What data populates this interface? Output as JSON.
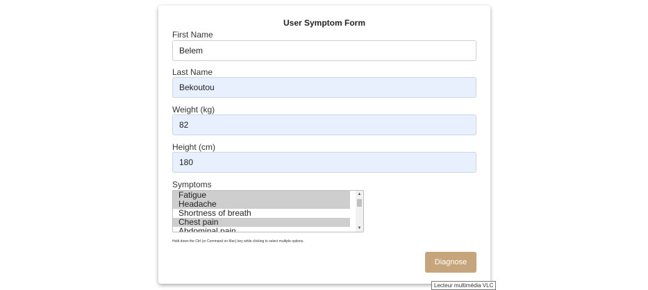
{
  "form": {
    "title": "User Symptom Form",
    "first_name": {
      "label": "First Name",
      "value": "Belem"
    },
    "last_name": {
      "label": "Last Name",
      "value": "Bekoutou"
    },
    "weight": {
      "label": "Weight (kg)",
      "value": "82"
    },
    "height": {
      "label": "Height (cm)",
      "value": "180"
    },
    "symptoms": {
      "label": "Symptoms",
      "options": [
        {
          "text": "Fatigue",
          "selected": true
        },
        {
          "text": "Headache",
          "selected": true
        },
        {
          "text": "Shortness of breath",
          "selected": false
        },
        {
          "text": "Chest pain",
          "selected": true
        },
        {
          "text": "Abdominal pain",
          "selected": false
        }
      ]
    },
    "hint": "Hold down the Ctrl (or Command on Mac) key while clicking to select multiple options.",
    "submit_label": "Diagnose"
  },
  "tooltip": "Lecteur multimédia VLC",
  "colors": {
    "accent_button": "#c7a57c",
    "autofill_bg": "#e8f0fe",
    "selected_option_bg": "#cecece"
  },
  "icons": {
    "scroll_up": "scroll-up-arrow-icon",
    "scroll_down": "scroll-down-arrow-icon"
  }
}
